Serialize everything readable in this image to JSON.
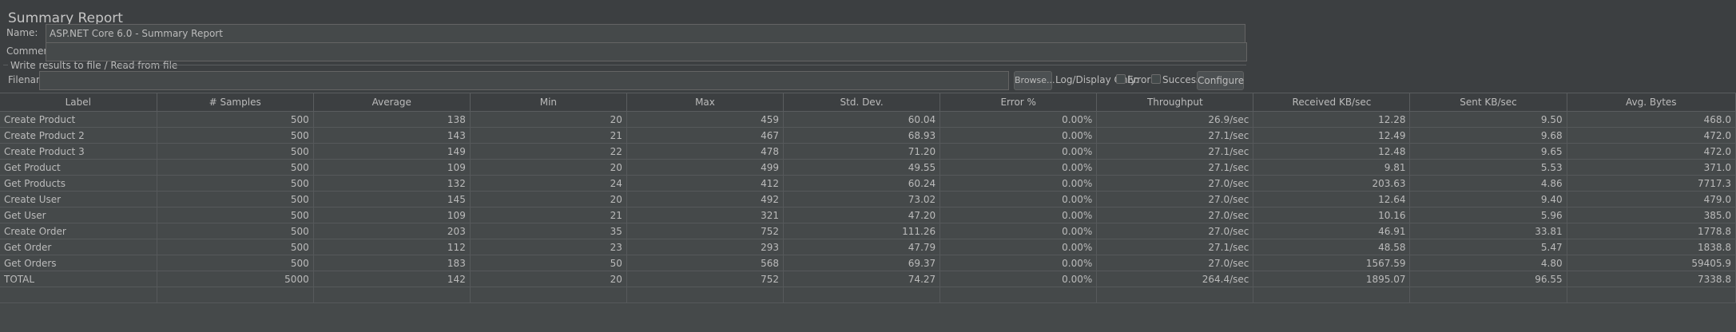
{
  "header": {
    "title": "Summary Report",
    "name_label": "Name:",
    "name_value": "ASP.NET Core 6.0 - Summary Report",
    "comments_label": "Comments:",
    "comments_value": ""
  },
  "file_section": {
    "legend": "Write results to file / Read from file",
    "filename_label": "Filename",
    "filename_value": "",
    "browse_label": "Browse...",
    "log_display_label": "Log/Display Only:",
    "errors_label": "Errors",
    "errors_checked": false,
    "successes_label": "Successes",
    "successes_checked": false,
    "configure_label": "Configure"
  },
  "table": {
    "columns": [
      "Label",
      "# Samples",
      "Average",
      "Min",
      "Max",
      "Std. Dev.",
      "Error %",
      "Throughput",
      "Received KB/sec",
      "Sent KB/sec",
      "Avg. Bytes"
    ],
    "rows": [
      [
        "Create Product",
        "500",
        "138",
        "20",
        "459",
        "60.04",
        "0.00%",
        "26.9/sec",
        "12.28",
        "9.50",
        "468.0"
      ],
      [
        "Create Product 2",
        "500",
        "143",
        "21",
        "467",
        "68.93",
        "0.00%",
        "27.1/sec",
        "12.49",
        "9.68",
        "472.0"
      ],
      [
        "Create Product 3",
        "500",
        "149",
        "22",
        "478",
        "71.20",
        "0.00%",
        "27.1/sec",
        "12.48",
        "9.65",
        "472.0"
      ],
      [
        "Get Product",
        "500",
        "109",
        "20",
        "499",
        "49.55",
        "0.00%",
        "27.1/sec",
        "9.81",
        "5.53",
        "371.0"
      ],
      [
        "Get Products",
        "500",
        "132",
        "24",
        "412",
        "60.24",
        "0.00%",
        "27.0/sec",
        "203.63",
        "4.86",
        "7717.3"
      ],
      [
        "Create User",
        "500",
        "145",
        "20",
        "492",
        "73.02",
        "0.00%",
        "27.0/sec",
        "12.64",
        "9.40",
        "479.0"
      ],
      [
        "Get User",
        "500",
        "109",
        "21",
        "321",
        "47.20",
        "0.00%",
        "27.0/sec",
        "10.16",
        "5.96",
        "385.0"
      ],
      [
        "Create Order",
        "500",
        "203",
        "35",
        "752",
        "111.26",
        "0.00%",
        "27.0/sec",
        "46.91",
        "33.81",
        "1778.8"
      ],
      [
        "Get Order",
        "500",
        "112",
        "23",
        "293",
        "47.79",
        "0.00%",
        "27.1/sec",
        "48.58",
        "5.47",
        "1838.8"
      ],
      [
        "Get Orders",
        "500",
        "183",
        "50",
        "568",
        "69.37",
        "0.00%",
        "27.0/sec",
        "1567.59",
        "4.80",
        "59405.9"
      ],
      [
        "TOTAL",
        "5000",
        "142",
        "20",
        "752",
        "74.27",
        "0.00%",
        "264.4/sec",
        "1895.07",
        "96.55",
        "7338.8"
      ]
    ]
  }
}
